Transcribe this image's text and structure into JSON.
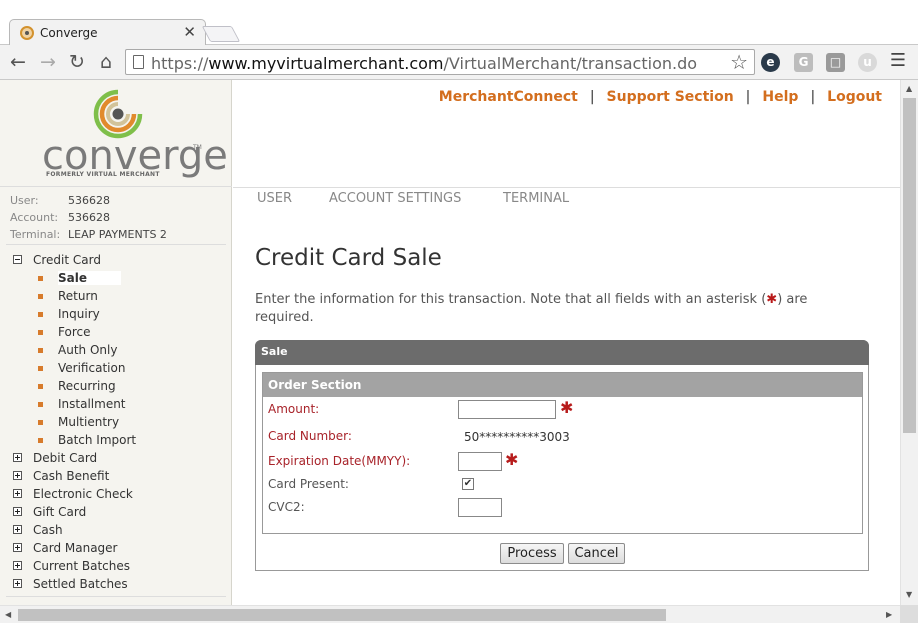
{
  "browser": {
    "tab_title": "Converge",
    "tab_close": "✕",
    "url_prefix": "https://",
    "url_host": "www.myvirtualmerchant.com",
    "url_path": "/VirtualMerchant/transaction.do"
  },
  "logo": {
    "word": "converge",
    "tm": "TM",
    "sub": "FORMERLY VIRTUAL MERCHANT"
  },
  "account_info": {
    "user_label": "User:",
    "user_value": "536628",
    "account_label": "Account:",
    "account_value": "536628",
    "terminal_label": "Terminal:",
    "terminal_value": "LEAP PAYMENTS 2"
  },
  "sidebar": {
    "credit_card": "Credit Card",
    "credit_items": [
      "Sale",
      "Return",
      "Inquiry",
      "Force",
      "Auth Only",
      "Verification",
      "Recurring",
      "Installment",
      "Multientry",
      "Batch Import"
    ],
    "other_items": [
      "Debit Card",
      "Cash Benefit",
      "Electronic Check",
      "Gift Card",
      "Cash",
      "Card Manager",
      "Current Batches",
      "Settled Batches"
    ]
  },
  "top_links": [
    "MerchantConnect",
    "Support Section",
    "Help",
    "Logout"
  ],
  "top_sep": "|",
  "nav_tabs": [
    "USER",
    "ACCOUNT SETTINGS",
    "TERMINAL"
  ],
  "page": {
    "title": "Credit Card Sale",
    "intro_before": "Enter the information for this transaction.  Note that all fields with an asterisk (",
    "intro_ast": "✱",
    "intro_after": ")  are required."
  },
  "form": {
    "panel_title": "Sale",
    "section_title": "Order Section",
    "amount_label": "Amount:",
    "card_number_label": "Card Number:",
    "card_number_value": "50**********3003",
    "expiration_label": "Expiration Date(MMYY):",
    "card_present_label": "Card Present:",
    "card_present_checked": true,
    "cvc2_label": "CVC2:",
    "required_marker": "✱",
    "process_button": "Process",
    "cancel_button": "Cancel"
  },
  "colors": {
    "accent": "#d36e1e",
    "required": "#a8232a",
    "panel_header": "#6c6c6c",
    "section_header": "#a3a3a3",
    "sidebar_bg": "#f5f4ef"
  }
}
